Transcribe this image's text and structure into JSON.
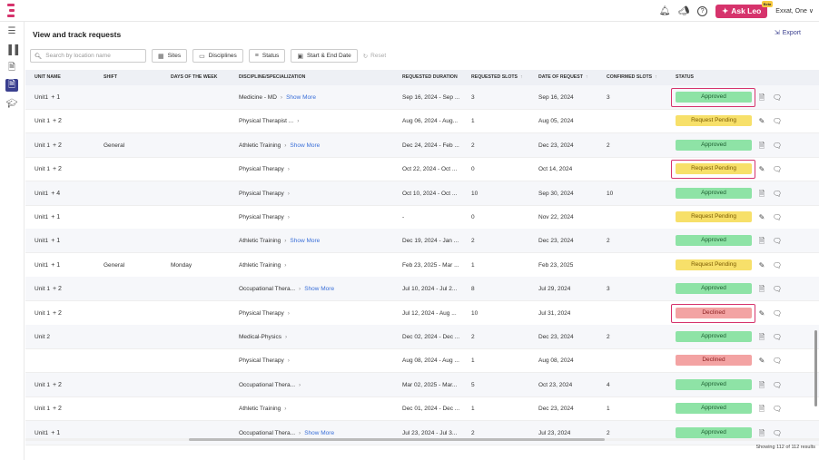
{
  "header": {
    "ask_leo": "Ask Leo",
    "beta": "Beta",
    "user": "Exxat, One"
  },
  "page": {
    "title": "View and track requests",
    "export": "Export",
    "footer": "Showing 112 of 112 results"
  },
  "filters": {
    "search_placeholder": "Search by location name",
    "sites": "Sites",
    "disciplines": "Disciplines",
    "status": "Status",
    "dates": "Start & End Date",
    "reset": "Reset"
  },
  "columns": {
    "unit": "UNIT NAME",
    "shift": "SHIFT",
    "days": "DAYS OF THE WEEK",
    "discipline": "DISCIPLINE/SPECIALIZATION",
    "duration": "REQUESTED DURATION",
    "slots": "REQUESTED SLOTS",
    "date": "DATE OF REQUEST",
    "confirmed": "CONFIRMED SLOTS",
    "status": "STATUS"
  },
  "colors": {
    "accent": "#d6336c",
    "approved": "#8ee3a6",
    "pending": "#f7e06a",
    "declined": "#f3a3a3"
  },
  "rows": [
    {
      "unit": "Unit1",
      "plus": "+ 1",
      "shift": "",
      "days": "",
      "disc": "Medicine - MD",
      "more": "Show More",
      "duration": "Sep 16, 2024 - Sep ...",
      "slots": "3",
      "date": "Sep 16, 2024",
      "confirmed": "3",
      "status": "Approved",
      "kind": "approved",
      "hl": true
    },
    {
      "unit": "Unit 1",
      "plus": "+ 2",
      "shift": "",
      "days": "",
      "disc": "Physical Therapist ...",
      "more": "",
      "duration": "Aug 06, 2024 - Aug...",
      "slots": "1",
      "date": "Aug 05, 2024",
      "confirmed": "",
      "status": "Request Pending",
      "kind": "pending",
      "hl": false
    },
    {
      "unit": "Unit 1",
      "plus": "+ 2",
      "shift": "General",
      "days": "",
      "disc": "Athletic Training",
      "more": "Show More",
      "duration": "Dec 24, 2024 - Feb ...",
      "slots": "2",
      "date": "Dec 23, 2024",
      "confirmed": "2",
      "status": "Approved",
      "kind": "approved",
      "hl": false
    },
    {
      "unit": "Unit 1",
      "plus": "+ 2",
      "shift": "",
      "days": "",
      "disc": "Physical Therapy",
      "more": "",
      "duration": "Oct 22, 2024 - Oct ...",
      "slots": "0",
      "date": "Oct 14, 2024",
      "confirmed": "",
      "status": "Request Pending",
      "kind": "pending",
      "hl": true
    },
    {
      "unit": "Unit1",
      "plus": "+ 4",
      "shift": "",
      "days": "",
      "disc": "Physical Therapy",
      "more": "",
      "duration": "Oct 10, 2024 - Oct ...",
      "slots": "10",
      "date": "Sep 30, 2024",
      "confirmed": "10",
      "status": "Approved",
      "kind": "approved",
      "hl": false
    },
    {
      "unit": "Unit1",
      "plus": "+ 1",
      "shift": "",
      "days": "",
      "disc": "Physical Therapy",
      "more": "",
      "duration": "-",
      "slots": "0",
      "date": "Nov 22, 2024",
      "confirmed": "",
      "status": "Request Pending",
      "kind": "pending",
      "hl": false
    },
    {
      "unit": "Unit1",
      "plus": "+ 1",
      "shift": "",
      "days": "",
      "disc": "Athletic Training",
      "more": "Show More",
      "duration": "Dec 19, 2024 - Jan ...",
      "slots": "2",
      "date": "Dec 23, 2024",
      "confirmed": "2",
      "status": "Approved",
      "kind": "approved",
      "hl": false
    },
    {
      "unit": "Unit1",
      "plus": "+ 1",
      "shift": "General",
      "days": "Monday",
      "disc": "Athletic Training",
      "more": "",
      "duration": "Feb 23, 2025 - Mar ...",
      "slots": "1",
      "date": "Feb 23, 2025",
      "confirmed": "",
      "status": "Request Pending",
      "kind": "pending",
      "hl": false
    },
    {
      "unit": "Unit 1",
      "plus": "+ 2",
      "shift": "",
      "days": "",
      "disc": "Occupational Thera...",
      "more": "Show More",
      "duration": "Jul 10, 2024 - Jul 2...",
      "slots": "8",
      "date": "Jul 29, 2024",
      "confirmed": "3",
      "status": "Approved",
      "kind": "approved",
      "hl": false
    },
    {
      "unit": "Unit 1",
      "plus": "+ 2",
      "shift": "",
      "days": "",
      "disc": "Physical Therapy",
      "more": "",
      "duration": "Jul 12, 2024 - Aug ...",
      "slots": "10",
      "date": "Jul 31, 2024",
      "confirmed": "",
      "status": "Declined",
      "kind": "declined",
      "hl": true
    },
    {
      "unit": "Unit 2",
      "plus": "",
      "shift": "",
      "days": "",
      "disc": "Medical-Physics",
      "more": "",
      "duration": "Dec 02, 2024 - Dec ...",
      "slots": "2",
      "date": "Dec 23, 2024",
      "confirmed": "2",
      "status": "Approved",
      "kind": "approved",
      "hl": false
    },
    {
      "unit": "",
      "plus": "",
      "shift": "",
      "days": "",
      "disc": "Physical Therapy",
      "more": "",
      "duration": "Aug 08, 2024 - Aug ...",
      "slots": "1",
      "date": "Aug 08, 2024",
      "confirmed": "",
      "status": "Declined",
      "kind": "declined",
      "hl": false
    },
    {
      "unit": "Unit 1",
      "plus": "+ 2",
      "shift": "",
      "days": "",
      "disc": "Occupational Thera...",
      "more": "",
      "duration": "Mar 02, 2025 - Mar...",
      "slots": "5",
      "date": "Oct 23, 2024",
      "confirmed": "4",
      "status": "Approved",
      "kind": "approved",
      "hl": false
    },
    {
      "unit": "Unit 1",
      "plus": "+ 2",
      "shift": "",
      "days": "",
      "disc": "Athletic Training",
      "more": "",
      "duration": "Dec 01, 2024 - Dec ...",
      "slots": "1",
      "date": "Dec 23, 2024",
      "confirmed": "1",
      "status": "Approved",
      "kind": "approved",
      "hl": false
    },
    {
      "unit": "Unit1",
      "plus": "+ 1",
      "shift": "",
      "days": "",
      "disc": "Occupational Thera...",
      "more": "Show More",
      "duration": "Jul 23, 2024 - Jul 3...",
      "slots": "2",
      "date": "Jul 23, 2024",
      "confirmed": "2",
      "status": "Approved",
      "kind": "approved",
      "hl": false
    }
  ]
}
